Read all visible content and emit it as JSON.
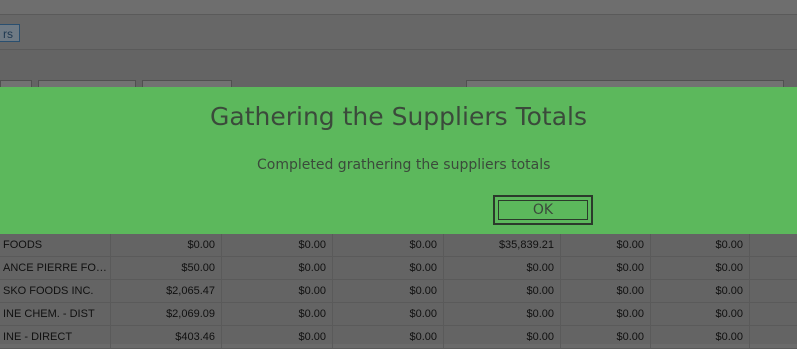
{
  "toolbar": {
    "tab_label": "rs"
  },
  "dialog": {
    "title": "Gathering the Suppliers Totals",
    "message": "Completed grathering the suppliers totals",
    "ok_label": "OK"
  },
  "grid": {
    "rows": [
      {
        "name": "FOODS",
        "values": [
          "$0.00",
          "$0.00",
          "$0.00",
          "$35,839.21",
          "$0.00",
          "$0.00"
        ]
      },
      {
        "name": "ANCE PIERRE FOOD...",
        "values": [
          "$50.00",
          "$0.00",
          "$0.00",
          "$0.00",
          "$0.00",
          "$0.00"
        ]
      },
      {
        "name": "SKO FOODS INC.",
        "values": [
          "$2,065.47",
          "$0.00",
          "$0.00",
          "$0.00",
          "$0.00",
          "$0.00"
        ]
      },
      {
        "name": "INE  CHEM. - DIST",
        "values": [
          "$2,069.09",
          "$0.00",
          "$0.00",
          "$0.00",
          "$0.00",
          "$0.00"
        ]
      },
      {
        "name": "INE - DIRECT",
        "values": [
          "$403.46",
          "$0.00",
          "$0.00",
          "$0.00",
          "$0.00",
          "$0.00"
        ]
      }
    ]
  }
}
